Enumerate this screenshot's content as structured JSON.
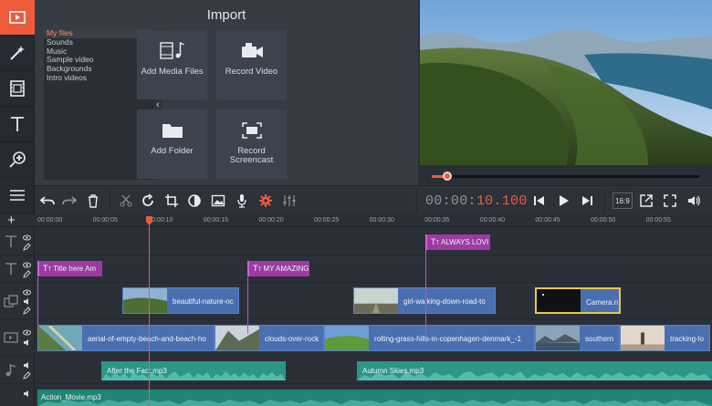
{
  "import": {
    "title": "Import",
    "categories": [
      "My files",
      "Sounds",
      "Music",
      "Sample video",
      "Backgrounds",
      "Intro videos"
    ],
    "active_category": "My files",
    "tiles": [
      {
        "label": "Add Media Files",
        "icon": "add-media-icon"
      },
      {
        "label": "Record Video",
        "icon": "camera-icon"
      },
      {
        "label": "Add Folder",
        "icon": "folder-icon"
      },
      {
        "label": "Record Screencast",
        "icon": "screencast-icon"
      }
    ]
  },
  "player": {
    "timecode_dim": "00:00:",
    "timecode_hi": "10.100",
    "aspect": "16:9",
    "progress": 0.02
  },
  "ruler": {
    "labels": [
      "00:00:00",
      "00:00:05",
      "00:00:10",
      "00:00:15",
      "00:00:20",
      "00:00:25",
      "00:00:30",
      "00:00:35",
      "00:00:40",
      "00:00:45",
      "00:00:50",
      "00:00:55"
    ]
  },
  "timeline": {
    "title_track_1": [
      {
        "text": "ALWAYS LOVI"
      }
    ],
    "title_track_2": [
      {
        "text": "Title here Am"
      },
      {
        "text": "MY AMAZING"
      }
    ],
    "overlay_track": [
      {
        "text": "beautiful-nature-nc"
      },
      {
        "text": "girl-walking-down-road-to"
      },
      {
        "text": "Camera.n"
      }
    ],
    "video_track": [
      {
        "text": "aerial-of-empty-beach-and-beach-ho"
      },
      {
        "text": "clouds-over-rock"
      },
      {
        "text": "rolling-grass-hills-in-copenhagen-denmark_-1"
      },
      {
        "text": "southern"
      },
      {
        "text": "tracking-lo"
      }
    ],
    "audio_track": [
      {
        "text": "After the Fact.mp3"
      },
      {
        "text": "Autumn Skies.mp3"
      }
    ],
    "music_track": [
      {
        "text": "Action_Movie.mp3"
      }
    ]
  },
  "colors": {
    "accent": "#ec5b3b",
    "title_clip": "#9b3ba3",
    "video_clip": "#4a6fb0",
    "audio_clip": "#2a9788"
  }
}
